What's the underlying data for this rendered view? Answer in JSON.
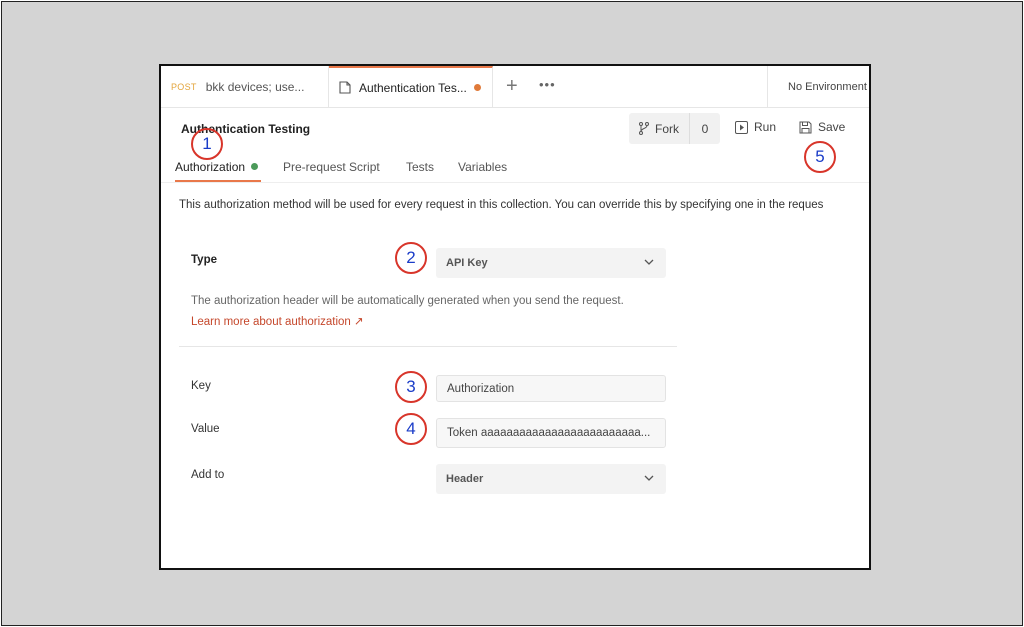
{
  "tabs": [
    {
      "method": "POST",
      "label": "bkk devices; use..."
    },
    {
      "label": "Authentication Tes...",
      "unsaved": true
    }
  ],
  "tab_actions": {
    "new_tab": "+",
    "more": "•••"
  },
  "environment": "No Environment",
  "collection": {
    "title": "Authentication Testing"
  },
  "actions": {
    "fork_label": "Fork",
    "fork_count": "0",
    "run_label": "Run",
    "save_label": "Save"
  },
  "subtabs": [
    "Authorization",
    "Pre-request Script",
    "Tests",
    "Variables"
  ],
  "description": "This authorization method will be used for every request in this collection. You can override this by specifying one in the reques",
  "auth": {
    "type_label": "Type",
    "type_value": "API Key",
    "helper_text": "The authorization header will be automatically generated when you send the request.",
    "learn_more": "Learn more about authorization ↗",
    "key_label": "Key",
    "key_value": "Authorization",
    "value_label": "Value",
    "value_value": "Token aaaaaaaaaaaaaaaaaaaaaaaaa...",
    "addto_label": "Add to",
    "addto_value": "Header"
  },
  "annotations": [
    "1",
    "2",
    "3",
    "4",
    "5"
  ],
  "colors": {
    "accent": "#e9784a",
    "annotation_ring": "#d8352a",
    "annotation_number": "#1a3cc8",
    "active_dot": "#4b9a5a"
  }
}
